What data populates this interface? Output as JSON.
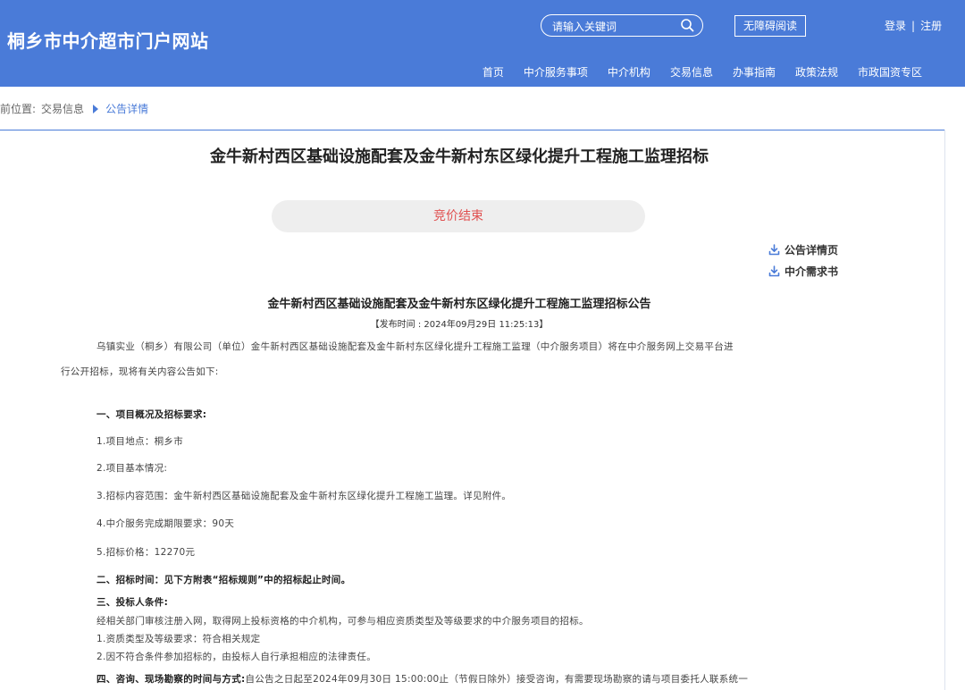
{
  "header": {
    "site_title": "桐乡市中介超市门户网站",
    "search_placeholder": "请输入关键词",
    "accessibility_label": "无障碍阅读",
    "login_label": "登录",
    "auth_separator": "|",
    "register_label": "注册",
    "nav": [
      "首页",
      "中介服务事项",
      "中介机构",
      "交易信息",
      "办事指南",
      "政策法规",
      "市政国资专区"
    ]
  },
  "breadcrumb": {
    "prefix": "前位置:",
    "level1": "交易信息",
    "current": "公告详情"
  },
  "page_title": "金牛新村西区基础设施配套及金牛新村东区绿化提升工程施工监理招标",
  "status_label": "竞价结束",
  "downloads": [
    "公告详情页",
    "中介需求书"
  ],
  "notice": {
    "title": "金牛新村西区基础设施配套及金牛新村东区绿化提升工程施工监理招标公告",
    "publish_time": "【发布时间 : 2024年09月29日 11:25:13】",
    "intro_line1": "乌镇实业（桐乡）有限公司（单位）金牛新村西区基础设施配套及金牛新村东区绿化提升工程施工监理（中介服务项目）将在中介服务网上交易平台进",
    "intro_line2": "行公开招标，现将有关内容公告如下:",
    "section1_title": "一、项目概况及招标要求:",
    "item1": "1.项目地点：桐乡市",
    "item2": "2.项目基本情况:",
    "item3": "3.招标内容范围：金牛新村西区基础设施配套及金牛新村东区绿化提升工程施工监理。详见附件。",
    "item4": "4.中介服务完成期限要求：90天",
    "item5": "5.招标价格：12270元",
    "section2_title": "二、招标时间：见下方附表“招标规则”中的招标起止时间。",
    "section3_title": "三、投标人条件:",
    "section3_line1": "经相关部门审核注册入网，取得网上投标资格的中介机构，可参与相应资质类型及等级要求的中介服务项目的招标。",
    "section3_line2": "1.资质类型及等级要求：符合相关规定",
    "section3_line3": "2.因不符合条件参加招标的，由投标人自行承担相应的法律责任。",
    "section4_title": "四、咨询、现场勘察的时间与方式:",
    "section4_text": "自公告之日起至2024年09月30日 15:00:00止（节假日除外）接受咨询，有需要现场勘察的请与项目委托人联系统一"
  },
  "colors": {
    "header_bg": "#4a7bd8",
    "status_text": "#e05050",
    "accent": "#4a7bd8"
  }
}
